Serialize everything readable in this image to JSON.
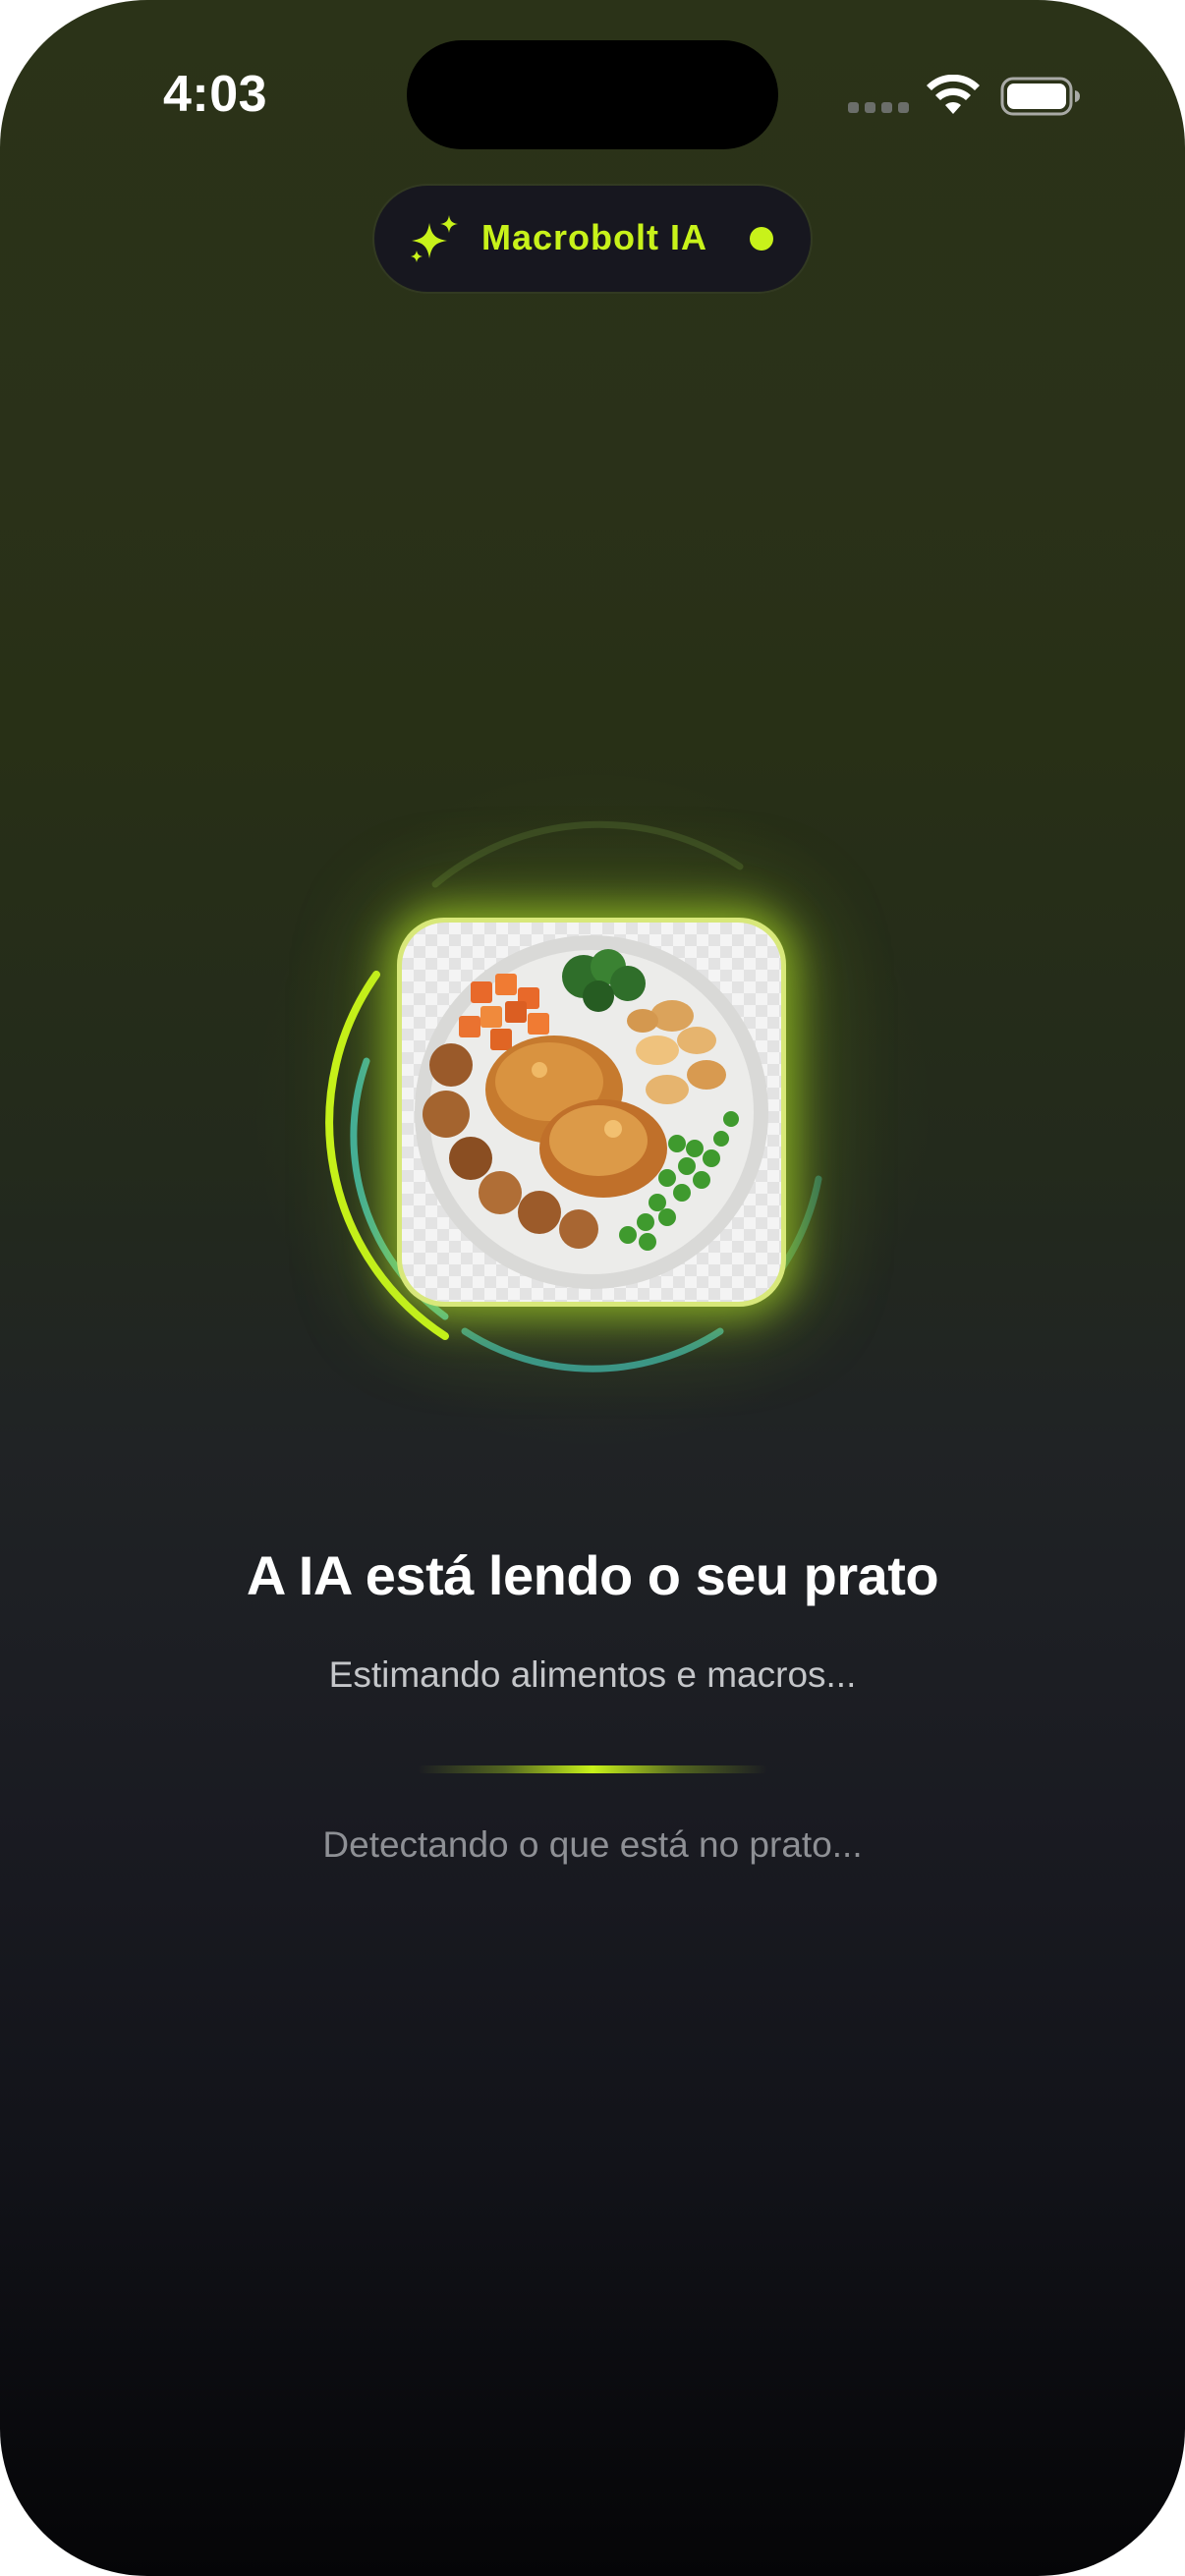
{
  "status_bar": {
    "time": "4:03"
  },
  "ai_badge": {
    "label": "Macrobolt IA",
    "icon": "sparkle-icon",
    "indicator": "live-dot",
    "accent_color": "#c8f21a"
  },
  "scanner": {
    "photo_description": "food-photo",
    "ring_colors": [
      "#c8f21a",
      "#3fb8b0",
      "#3b5a2a"
    ]
  },
  "analysis": {
    "title": "A IA está lendo o seu prato",
    "subtitle": "Estimando alimentos e macros...",
    "status": "Detectando o que está no prato..."
  }
}
